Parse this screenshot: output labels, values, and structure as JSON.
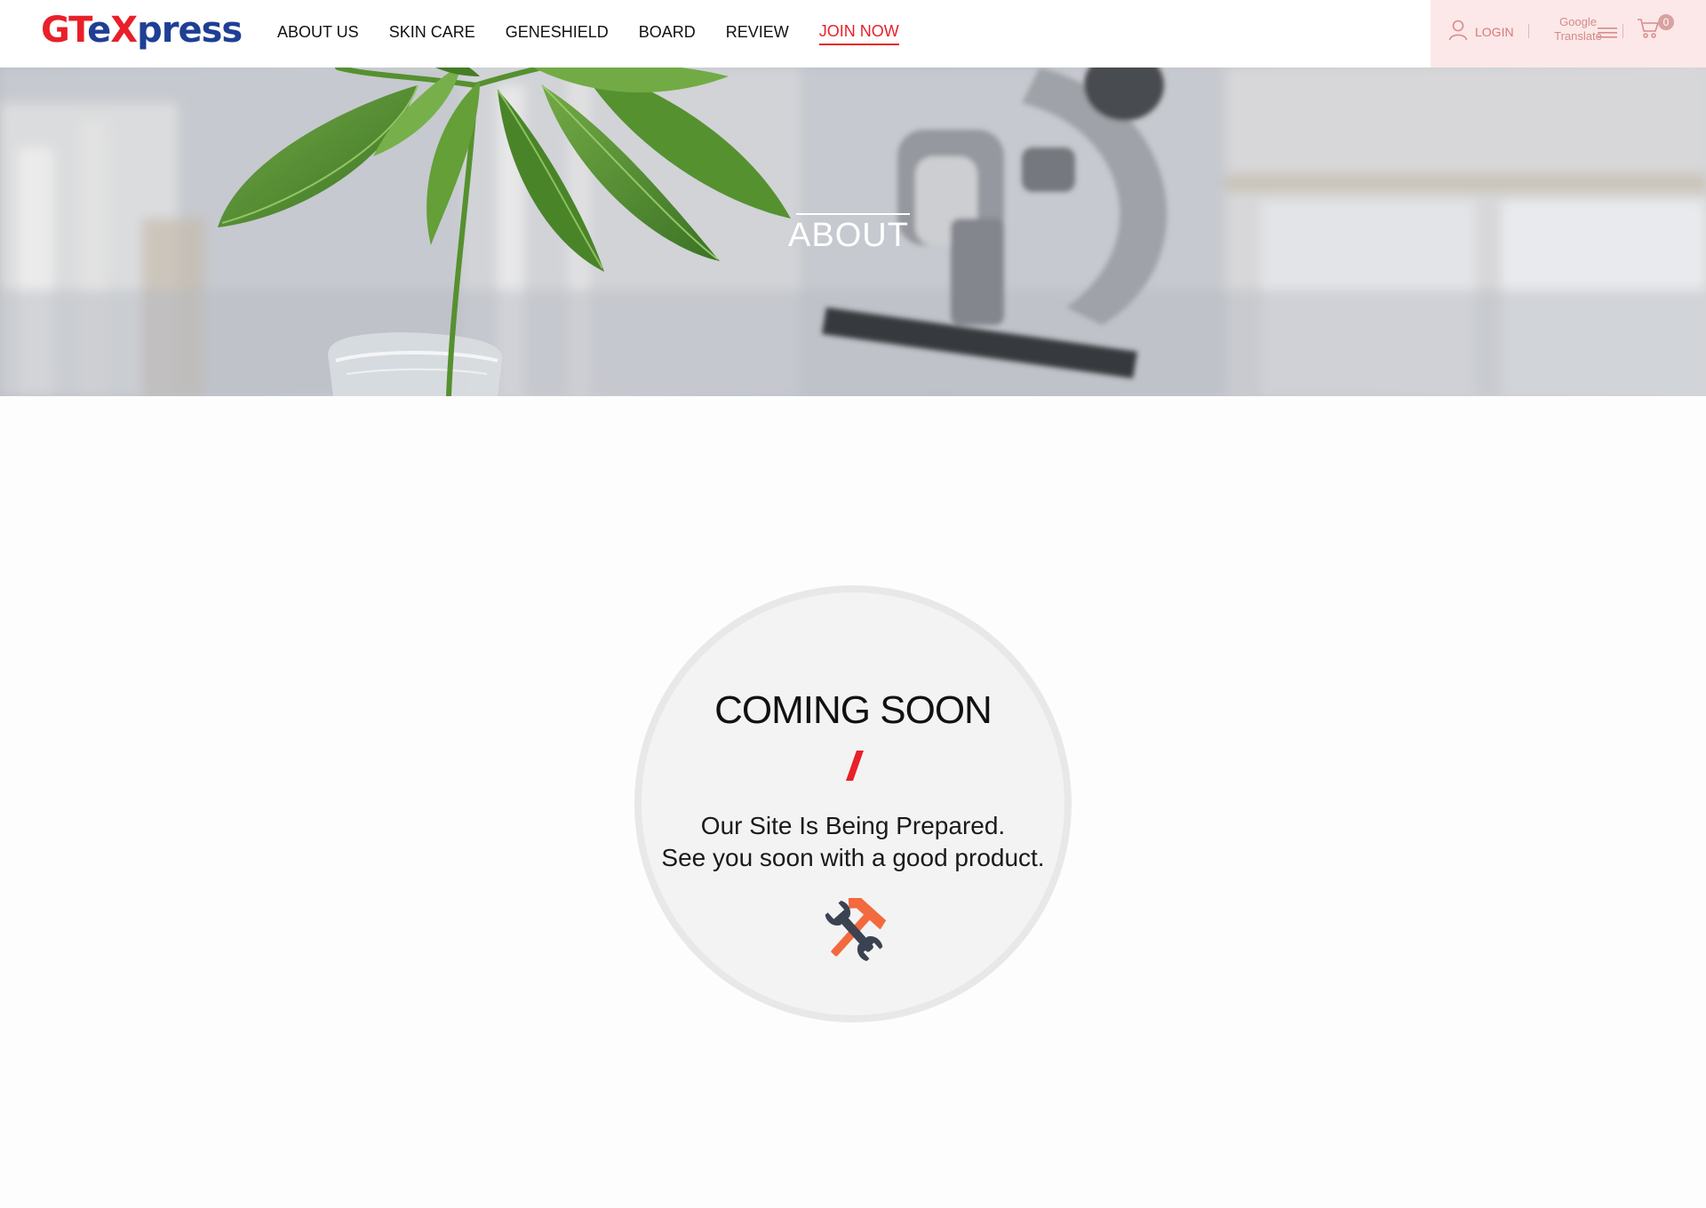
{
  "logo": {
    "part1": "GT",
    "part2": "e",
    "part3": "X",
    "part4": "press",
    "colors": {
      "red": "#e8202a",
      "blue": "#1f3f95"
    }
  },
  "nav": {
    "items": [
      {
        "label": "ABOUT US"
      },
      {
        "label": "SKIN CARE"
      },
      {
        "label": "GENESHIELD"
      },
      {
        "label": "BOARD"
      },
      {
        "label": "REVIEW"
      },
      {
        "label": "JOIN NOW",
        "active": true
      }
    ]
  },
  "util": {
    "login_label": "LOGIN",
    "google_translate_line1": "Google",
    "google_translate_line2": "Translate",
    "cart_count": "0",
    "icons": [
      "user-icon",
      "menu-icon",
      "cart-icon"
    ]
  },
  "hero": {
    "title": "ABOUT"
  },
  "coming_soon": {
    "title": "COMING SOON",
    "line1": "Our Site Is Being Prepared.",
    "line2": "See you soon with a good product.",
    "accent_color": "#e8202a",
    "icon": "tools-icon"
  }
}
